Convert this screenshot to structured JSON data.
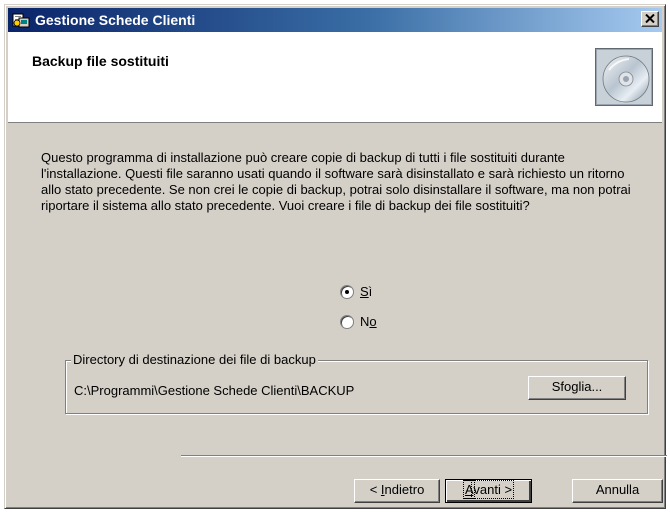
{
  "window": {
    "title": "Gestione Schede Clienti",
    "icon": "installer-app-icon",
    "close_icon": "close-x-icon"
  },
  "header": {
    "title": "Backup file sostituiti",
    "icon": "cd-disc-icon"
  },
  "body": {
    "description": "Questo programma di installazione può creare copie di backup di tutti i file sostituiti durante l'installazione. Questi file saranno usati quando il software sarà disinstallato e sarà richiesto un ritorno allo stato precedente. Se non crei le copie di backup, potrai solo disinstallare il software, ma non potrai riportare il sistema allo stato precedente. Vuoi creare i file di backup dei file sostituiti?"
  },
  "options": {
    "yes": {
      "prefix": "",
      "accel": "S",
      "rest": "ì",
      "selected": true
    },
    "no": {
      "prefix": "N",
      "accel": "o",
      "rest": "",
      "selected": false
    }
  },
  "destination": {
    "legend": "Directory di destinazione dei file di backup",
    "path": "C:\\Programmi\\Gestione Schede Clienti\\BACKUP",
    "browse_label": "Sfoglia..."
  },
  "buttons": {
    "back": {
      "prefix": "< ",
      "accel": "I",
      "rest": "ndietro"
    },
    "next": {
      "prefix": "",
      "accel": "A",
      "rest": "vanti >"
    },
    "cancel": "Annulla"
  },
  "colors": {
    "dialog_bg": "#d4d0c8",
    "titlebar_start": "#0a246a",
    "titlebar_end": "#a6caf0",
    "header_bg": "#ffffff"
  }
}
